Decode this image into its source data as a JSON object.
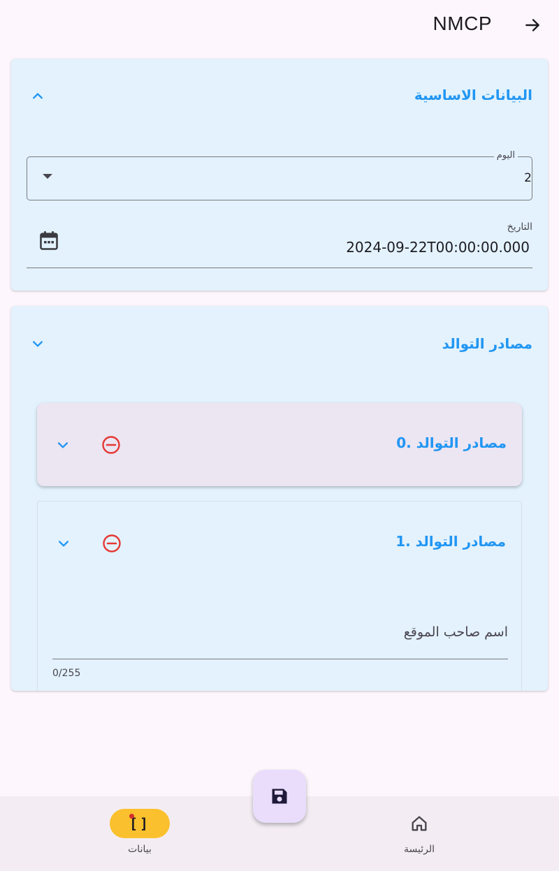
{
  "appbar": {
    "title": "NMCP",
    "back_icon": "arrow-right-icon"
  },
  "basic_section": {
    "title": "البيانات الاساسية",
    "expanded": true,
    "day_field": {
      "label": "اليوم",
      "value": "2"
    },
    "date_field": {
      "label": "التاريخ",
      "value": "2024-09-22T00:00:00.000"
    }
  },
  "sources_section": {
    "title": "مصادر التوالد",
    "items": [
      {
        "title": "0. مصادر التوالد"
      },
      {
        "title": "1. مصادر التوالد",
        "owner_field": {
          "placeholder": "اسم صاحب الموقع",
          "counter": "0/255"
        }
      }
    ]
  },
  "bottom_nav": {
    "home_label": "الرئيسة",
    "data_label": "بيانات"
  },
  "colors": {
    "accent": "#2196f3",
    "card_bg": "#e3f2fd",
    "remove": "#e53935",
    "nav_selected": "#fbc02d",
    "fab": "#e9ddfb"
  }
}
